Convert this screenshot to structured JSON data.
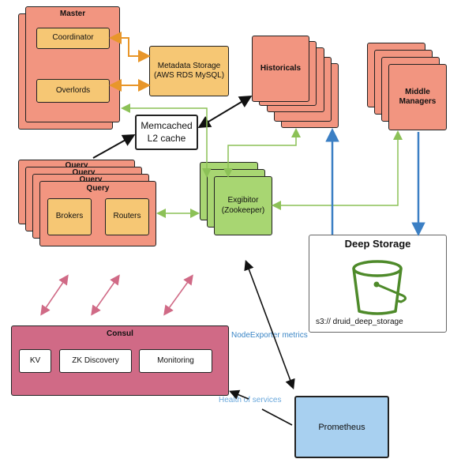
{
  "master": {
    "title": "Master",
    "coordinator": "Coordinator",
    "overlords": "Overlords"
  },
  "metadata": {
    "line1": "Metadata Storage",
    "line2": "(AWS RDS MySQL)"
  },
  "memcached": {
    "line1": "Memcached",
    "line2": "L2 cache"
  },
  "historicals": {
    "title": "Historicals"
  },
  "middle_managers": {
    "line1": "Middle",
    "line2": "Managers"
  },
  "query": {
    "title": "Query",
    "brokers": "Brokers",
    "routers": "Routers"
  },
  "exhibitor": {
    "line1": "Exgibitor",
    "line2": "(Zookeeper)"
  },
  "deep_storage": {
    "title": "Deep Storage",
    "path": "s3:// druid_deep_storage",
    "icon": "s3-bucket-icon"
  },
  "consul": {
    "title": "Consul",
    "kv": "KV",
    "zk": "ZK Discovery",
    "monitoring": "Monitoring"
  },
  "prometheus": {
    "title": "Prometheus"
  },
  "edge_labels": {
    "node_exporter": "NodeExporter metrics",
    "health": "Health of services"
  },
  "colors": {
    "salmon": "#f29580",
    "orange": "#f6c774",
    "green": "#a8d672",
    "pink": "#d06a86",
    "blue": "#a8d0f0",
    "orange_arrow": "#e8962a",
    "green_arrow": "#8cc157",
    "blue_arrow": "#3b7fc4",
    "pink_arrow": "#d06a86",
    "label_blue": "#3b86c6"
  }
}
